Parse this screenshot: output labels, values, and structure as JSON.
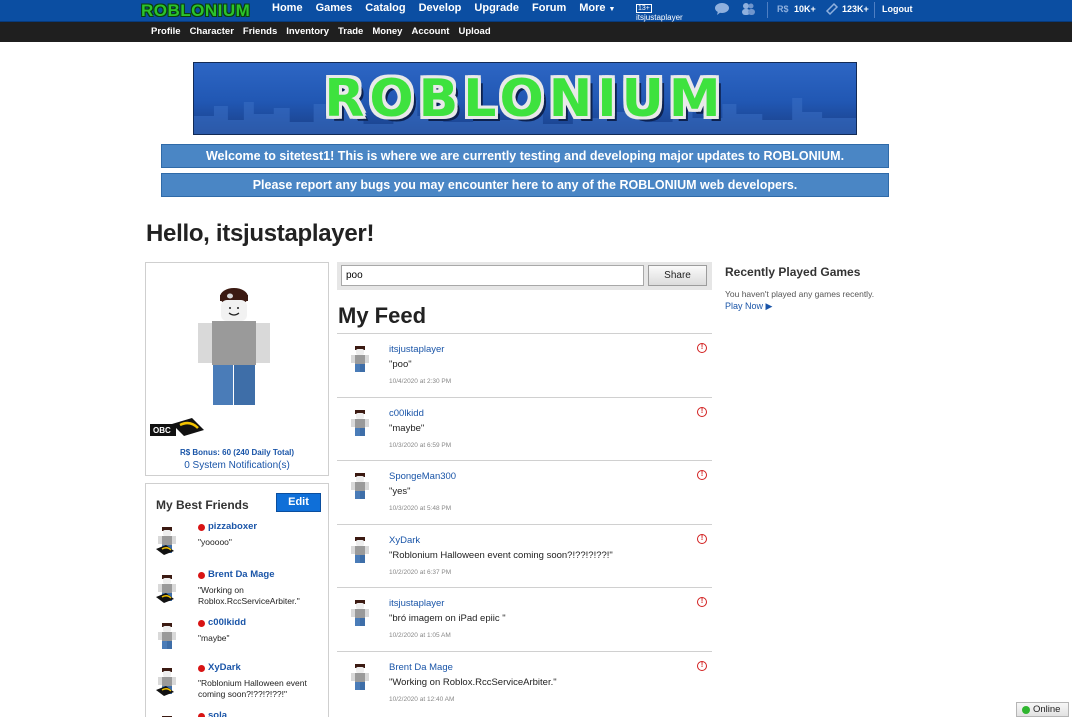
{
  "header": {
    "logo_text": "ROBLONIUM",
    "nav": [
      {
        "label": "Home"
      },
      {
        "label": "Games"
      },
      {
        "label": "Catalog"
      },
      {
        "label": "Develop"
      },
      {
        "label": "Upgrade"
      },
      {
        "label": "Forum"
      },
      {
        "label": "More"
      }
    ],
    "age_badge": "13+",
    "username": "itsjustaplayer",
    "robux_label": "R$",
    "robux_count": "10K+",
    "tix_count": "123K+",
    "logout_label": "Logout",
    "icons": [
      "chat-icon",
      "friends-icon",
      "robux-icon",
      "tix-icon"
    ]
  },
  "subnav": [
    {
      "label": "Profile"
    },
    {
      "label": "Character"
    },
    {
      "label": "Friends"
    },
    {
      "label": "Inventory"
    },
    {
      "label": "Trade"
    },
    {
      "label": "Money"
    },
    {
      "label": "Account"
    },
    {
      "label": "Upload"
    }
  ],
  "banner": {
    "text": "ROBLONIUM"
  },
  "notices": [
    "Welcome to sitetest1! This is where we are currently testing and developing major updates to ROBLONIUM.",
    "Please report any bugs you may encounter here to any of the ROBLONIUM web developers."
  ],
  "greeting": "Hello, itsjustaplayer!",
  "profile": {
    "membership_badge": "OBC",
    "rs_bonus": "R$ Bonus: 60 (240 Daily Total)",
    "notifications": "0 System Notification(s)"
  },
  "best_friends": {
    "title": "My Best Friends",
    "edit_label": "Edit",
    "friends": [
      {
        "name": "pizzaboxer",
        "status": "\"yooooo\"",
        "obc": true
      },
      {
        "name": "Brent Da Mage",
        "status": "\"Working on Roblox.RccServiceArbiter.\"",
        "obc": true
      },
      {
        "name": "c00lkidd",
        "status": "\"maybe\"",
        "obc": false
      },
      {
        "name": "XyDark",
        "status": "\"Roblonium Halloween event coming soon?!??!?!??!\"",
        "obc": true
      },
      {
        "name": "sola",
        "status": "",
        "obc": false
      }
    ]
  },
  "status_box": {
    "value": "poo",
    "share_label": "Share"
  },
  "feed": {
    "title": "My Feed",
    "items": [
      {
        "author": "itsjustaplayer",
        "message": "\"poo\"",
        "time": "10/4/2020 at 2:30 PM"
      },
      {
        "author": "c00lkidd",
        "message": "\"maybe\"",
        "time": "10/3/2020 at 6:59 PM"
      },
      {
        "author": "SpongeMan300",
        "message": "\"yes\"",
        "time": "10/3/2020 at 5:48 PM"
      },
      {
        "author": "XyDark",
        "message": "\"Roblonium Halloween event coming soon?!??!?!??!\"",
        "time": "10/2/2020 at 6:37 PM"
      },
      {
        "author": "itsjustaplayer",
        "message": "\"bró imagem on iPad epiic \"",
        "time": "10/2/2020 at 1:05 AM"
      },
      {
        "author": "Brent Da Mage",
        "message": "\"Working on Roblox.RccServiceArbiter.\"",
        "time": "10/2/2020 at 12:40 AM"
      }
    ]
  },
  "recent_games": {
    "title": "Recently Played Games",
    "empty_text": "You haven't played any games recently.",
    "play_now_label": "Play Now"
  },
  "online_status": "Online",
  "colors": {
    "nav_blue": "#0b4ea2",
    "subnav_black": "#1f1f1f",
    "notice_blue": "#4a86c5",
    "link_blue": "#1a55a8",
    "edit_button": "#0f6fd8",
    "online_green": "#2fb52f",
    "offline_red": "#d81414"
  }
}
